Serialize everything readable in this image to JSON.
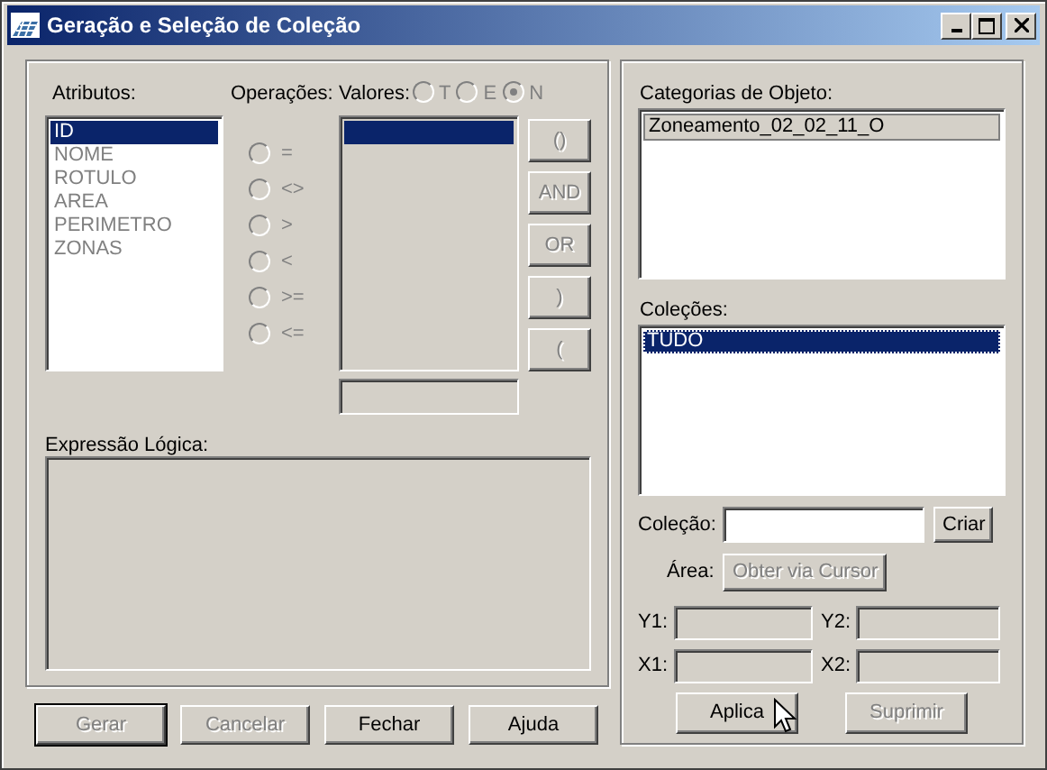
{
  "window": {
    "title": "Geração e Seleção de Coleção"
  },
  "left": {
    "attributes": {
      "label": "Atributos:",
      "disabled": true,
      "items": [
        {
          "text": "ID",
          "selected": true
        },
        {
          "text": "NOME",
          "selected": false
        },
        {
          "text": "ROTULO",
          "selected": false
        },
        {
          "text": "AREA",
          "selected": false
        },
        {
          "text": "PERIMETRO",
          "selected": false
        },
        {
          "text": "ZONAS",
          "selected": false
        }
      ]
    },
    "operations": {
      "label": "Operações:",
      "disabled": true,
      "items": [
        {
          "text": "=",
          "checked": false
        },
        {
          "text": "<>",
          "checked": false
        },
        {
          "text": ">",
          "checked": false
        },
        {
          "text": "<",
          "checked": false
        },
        {
          "text": ">=",
          "checked": false
        },
        {
          "text": "<=",
          "checked": false
        }
      ]
    },
    "values": {
      "label": "Valores:",
      "disabled": true,
      "types": [
        {
          "text": "T",
          "checked": false
        },
        {
          "text": "E",
          "checked": false
        },
        {
          "text": "N",
          "checked": true
        }
      ],
      "row_highlighted": true
    },
    "operators": [
      {
        "text": "()",
        "disabled": true
      },
      {
        "text": "AND",
        "disabled": true
      },
      {
        "text": "OR",
        "disabled": true
      },
      {
        "text": ")",
        "disabled": true
      },
      {
        "text": "(",
        "disabled": true
      }
    ],
    "expression_label": "Expressão Lógica:"
  },
  "buttons": [
    {
      "text": "Gerar",
      "disabled": true,
      "default": true
    },
    {
      "text": "Cancelar",
      "disabled": true,
      "default": false
    },
    {
      "text": "Fechar",
      "disabled": false,
      "default": false
    },
    {
      "text": "Ajuda",
      "disabled": false,
      "default": false
    }
  ],
  "right": {
    "categories": {
      "label": "Categorias de Objeto:",
      "items": [
        {
          "text": "Zoneamento_02_02_11_O",
          "selected": true
        }
      ]
    },
    "collections": {
      "label": "Coleções:",
      "items": [
        {
          "text": "TUDO",
          "selected": true
        }
      ]
    },
    "collection_field": {
      "label": "Coleção:",
      "button": {
        "text": "Criar",
        "disabled": false
      }
    },
    "area": {
      "label": "Área:",
      "button": {
        "text": "Obter via Cursor",
        "disabled": true
      }
    },
    "coords": [
      [
        "Y1:",
        "Y2:"
      ],
      [
        "X1:",
        "X2:"
      ]
    ],
    "actions": [
      {
        "text": "Aplica",
        "disabled": false
      },
      {
        "text": "Suprimir",
        "disabled": true
      }
    ]
  }
}
